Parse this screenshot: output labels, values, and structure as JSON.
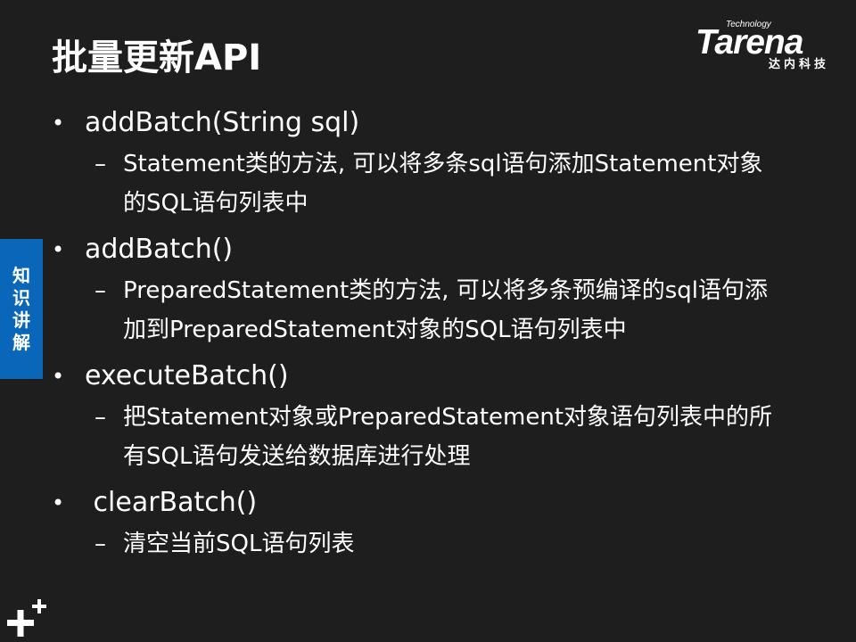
{
  "slide": {
    "title": "批量更新API",
    "side_tab": "知识讲解",
    "logo": {
      "brand": "Tarena",
      "tagline": "Technology",
      "cn": "达内科技"
    },
    "items": [
      {
        "bullet": "•",
        "text": "addBatch(String sql)",
        "dash": "–",
        "detail": "Statement类的方法, 可以将多条sql语句添加Statement对象的SQL语句列表中"
      },
      {
        "bullet": "•",
        "text": "addBatch()",
        "dash": "–",
        "detail": "PreparedStatement类的方法, 可以将多条预编译的sql语句添加到PreparedStatement对象的SQL语句列表中"
      },
      {
        "bullet": "•",
        "text": "executeBatch()",
        "dash": "–",
        "detail": "把Statement对象或PreparedStatement对象语句列表中的所有SQL语句发送给数据库进行处理"
      },
      {
        "bullet": "•",
        "text": " clearBatch()",
        "dash": "–",
        "detail": "清空当前SQL语句列表"
      }
    ]
  },
  "colors": {
    "background": "#1e1e1e",
    "side_tab": "#0a66b8",
    "text": "#ffffff"
  }
}
